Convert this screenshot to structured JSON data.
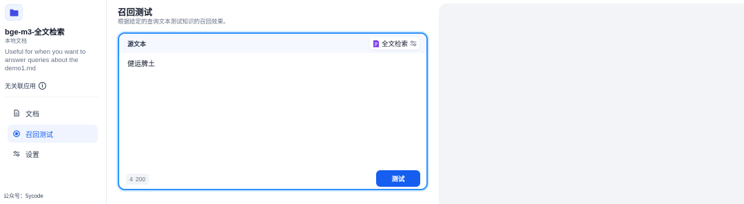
{
  "sidebar": {
    "dataset_icon": "folder-icon",
    "dataset_name": "bge-m3-全文检索",
    "dataset_subtitle": "本地文档",
    "dataset_description": "Useful for when you want to answer queries about the demo1.md",
    "no_linked_app": "无关联应用",
    "info_icon": "info-icon",
    "nav": [
      {
        "label": "文档",
        "icon": "document-icon",
        "active": false
      },
      {
        "label": "召回测试",
        "icon": "target-icon",
        "active": true
      },
      {
        "label": "设置",
        "icon": "settings-sliders-icon",
        "active": false
      }
    ],
    "footer_note": "公众号：5ycode"
  },
  "main": {
    "title": "召回测试",
    "subtitle": "根据给定的查询文本测试知识的召回效果。",
    "source_label": "源文本",
    "retrieval_method": "全文检索",
    "retrieval_icon": "fulltext-search-icon",
    "settings_icon": "sliders-icon",
    "query_text": "健运脾土",
    "char_count": "4",
    "char_limit": "200",
    "test_button": "测试"
  },
  "colors": {
    "accent": "#155eef",
    "active_nav_bg": "#eff4ff",
    "card_border": "#2e90fa",
    "panel_bg": "#f2f4f7"
  }
}
